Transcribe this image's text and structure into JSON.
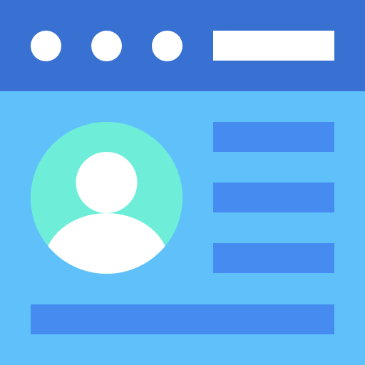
{
  "colors": {
    "titlebar": "#3871D1",
    "content": "#60C1FA",
    "window_dots": "#FFFFFF",
    "address_bar": "#FFFFFF",
    "avatar_circle": "#6EEED8",
    "avatar_figure": "#FFFFFF",
    "text_lines": "#458BF0"
  },
  "icons": {
    "avatar": "user-profile-icon",
    "window_dot": "window-control-dot"
  },
  "text_lines": 4
}
